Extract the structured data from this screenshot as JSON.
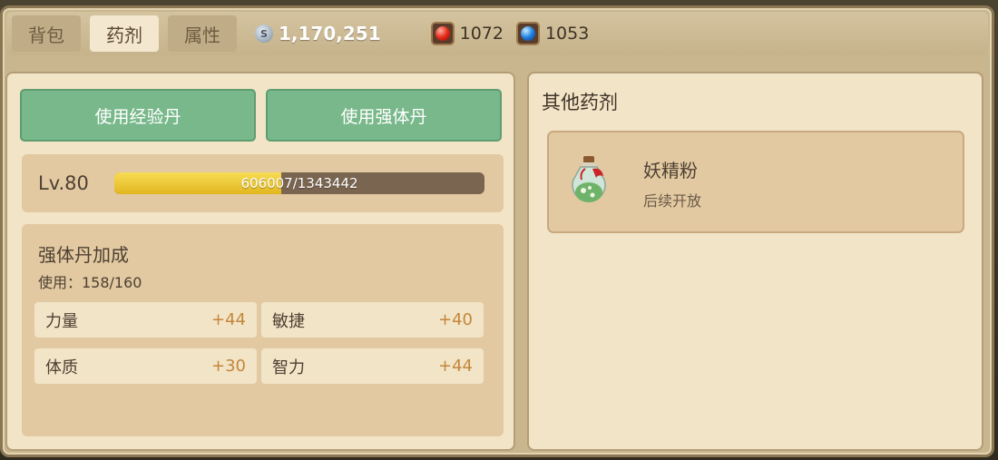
{
  "tabs": [
    {
      "label": "背包",
      "active": false
    },
    {
      "label": "药剂",
      "active": true
    },
    {
      "label": "属性",
      "active": false
    }
  ],
  "currency": {
    "coin_icon": "silver-coin-icon",
    "coin_symbol": "S",
    "coin_value": "1,170,251",
    "red_gem_icon": "red-gem-icon",
    "red_gem_value": "1072",
    "blue_gem_icon": "blue-gem-icon",
    "blue_gem_value": "1053"
  },
  "buttons": {
    "use_exp_pill": "使用经验丹",
    "use_body_pill": "使用强体丹"
  },
  "level": {
    "label": "Lv.80",
    "exp_current": 606007,
    "exp_max": 1343442,
    "exp_text": "606007/1343442",
    "exp_fraction": 0.451
  },
  "bonus": {
    "title": "强体丹加成",
    "usage": "使用：158/160",
    "stats": [
      {
        "name": "力量",
        "value": "+44"
      },
      {
        "name": "敏捷",
        "value": "+40"
      },
      {
        "name": "体质",
        "value": "+30"
      },
      {
        "name": "智力",
        "value": "+44"
      }
    ]
  },
  "other_potions": {
    "title": "其他药剂",
    "items": [
      {
        "icon": "fairy-dust-bottle-icon",
        "name": "妖精粉",
        "status": "后续开放"
      }
    ]
  },
  "colors": {
    "accent_green": "#78b88a",
    "exp_fill": "#e2b71f",
    "stat_value": "#c4863a"
  }
}
